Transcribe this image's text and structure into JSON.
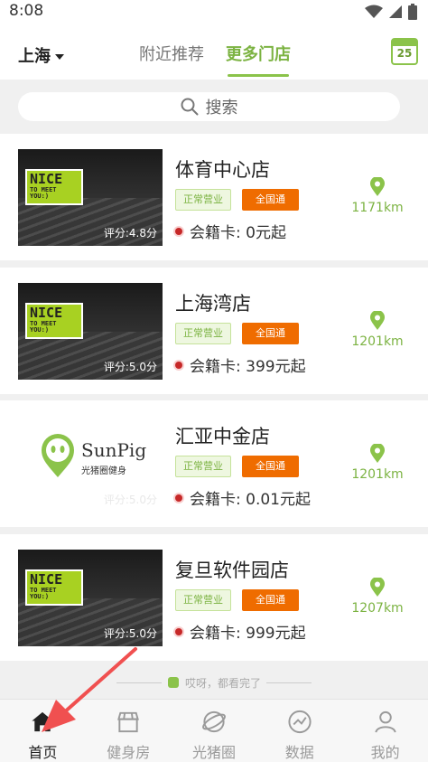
{
  "status_bar": {
    "time": "8:08"
  },
  "header": {
    "city": "上海",
    "tabs": [
      {
        "label": "附近推荐"
      },
      {
        "label": "更多门店"
      }
    ],
    "active_tab": "更多门店",
    "calendar_day": "25"
  },
  "search": {
    "placeholder": "搜索"
  },
  "stores": [
    {
      "name": "体育中心店",
      "rating": "评分:4.8分",
      "status": "正常营业",
      "tag": "全国通",
      "price": "会籍卡: 0元起",
      "distance": "1171km",
      "image": "gym-photo"
    },
    {
      "name": "上海湾店",
      "rating": "评分:5.0分",
      "status": "正常营业",
      "tag": "全国通",
      "price": "会籍卡: 399元起",
      "distance": "1201km",
      "image": "gym-photo"
    },
    {
      "name": "汇亚中金店",
      "rating": "评分:5.0分",
      "status": "正常营业",
      "tag": "全国通",
      "price": "会籍卡: 0.01元起",
      "distance": "1201km",
      "image": "sunpig-logo"
    },
    {
      "name": "复旦软件园店",
      "rating": "评分:5.0分",
      "status": "正常营业",
      "tag": "全国通",
      "price": "会籍卡: 999元起",
      "distance": "1207km",
      "image": "gym-photo"
    }
  ],
  "image_text": {
    "nice": "NICE",
    "to_meet_you": "TO MEET YOU:)",
    "sunpig": "SunPig",
    "sunpig_sub": "光猪圈健身"
  },
  "end_hint": "哎呀，都看完了",
  "tabbar": [
    {
      "label": "首页",
      "icon": "home-icon",
      "active": true
    },
    {
      "label": "健身房",
      "icon": "gym-icon",
      "active": false
    },
    {
      "label": "光猪圈",
      "icon": "planet-icon",
      "active": false
    },
    {
      "label": "数据",
      "icon": "chart-icon",
      "active": false
    },
    {
      "label": "我的",
      "icon": "user-icon",
      "active": false
    }
  ],
  "colors": {
    "accent": "#8bc34a",
    "tag_orange": "#ef6c00",
    "arrow": "#f05050"
  }
}
